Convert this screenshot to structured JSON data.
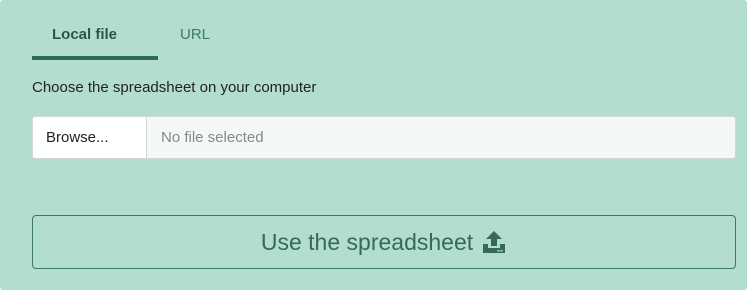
{
  "tabs": {
    "local_file": "Local file",
    "url": "URL"
  },
  "prompt_text": "Choose the spreadsheet on your computer",
  "file_input": {
    "browse_label": "Browse...",
    "placeholder": "No file selected"
  },
  "submit": {
    "label": "Use the spreadsheet",
    "icon": "upload-icon"
  },
  "colors": {
    "panel_bg": "#b3ddcf",
    "accent": "#2f6a54",
    "button_text": "#356b55"
  }
}
